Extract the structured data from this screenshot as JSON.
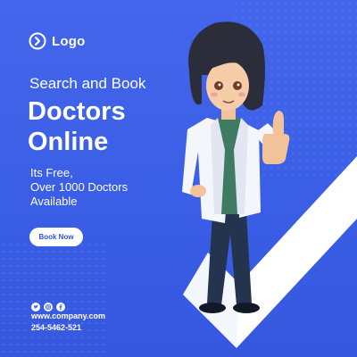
{
  "brand": {
    "logo_label": "Logo",
    "logo_icon": "arrow-circle-icon"
  },
  "headline": {
    "line1": "Search and Book",
    "line2": "Doctors",
    "line3": "Online"
  },
  "description": {
    "line1": "Its Free,",
    "line2": "Over 1000 Doctors",
    "line3": "Available"
  },
  "cta": {
    "label": "Book Now"
  },
  "contact": {
    "social_icons": [
      "twitter-icon",
      "instagram-icon",
      "facebook-icon"
    ],
    "website": "www.company.com",
    "phone": "254-5462-521"
  },
  "colors": {
    "background": "#3b5fe6",
    "accent": "#ffffff",
    "button_text": "#2f52d8"
  }
}
